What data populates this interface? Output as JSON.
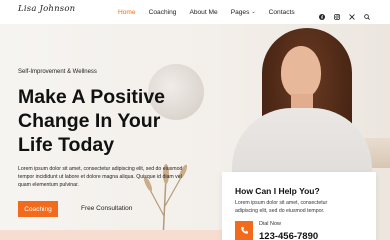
{
  "header": {
    "logo": "Lisa Johnson",
    "nav": [
      {
        "label": "Home",
        "active": true
      },
      {
        "label": "Coaching",
        "active": false
      },
      {
        "label": "About Me",
        "active": false
      },
      {
        "label": "Pages",
        "active": false,
        "dropdown": true
      },
      {
        "label": "Contacts",
        "active": false
      }
    ],
    "social": [
      "facebook-icon",
      "instagram-icon",
      "x-icon",
      "search-icon"
    ]
  },
  "hero": {
    "tagline": "Self-Improvement & Wellness",
    "headline_line1": "Make A Positive",
    "headline_line2": "Change In Your",
    "headline_line3": "Life Today",
    "description": "Lorem ipsum dolor sit amet, consectetur adipiscing elit, sed do eiusmod tempor incididunt ut labore et dolore magna aliqua. Quisque id diam vel quam elementum pulvinar.",
    "primary_button": "Coaching",
    "secondary_link": "Free Consultation"
  },
  "help_card": {
    "title": "How Can I Help You?",
    "text": "Lorem ipsum dolor sit amet, consectetur adipiscing elit, sed do eiusmod tempor.",
    "dial_label": "Dial Now",
    "phone": "123-456-7890"
  },
  "colors": {
    "accent": "#f26b1d",
    "text": "#111111",
    "background": "#f4f1ee"
  }
}
